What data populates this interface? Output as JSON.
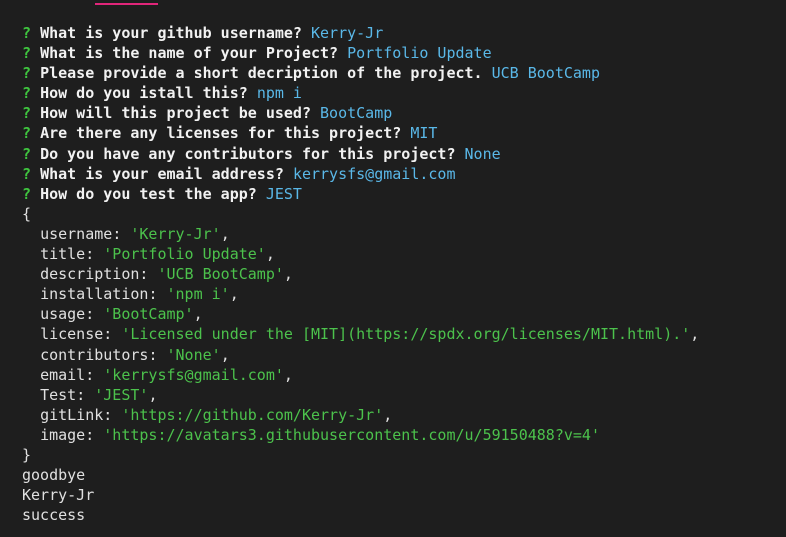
{
  "colors": {
    "background": "#1e1e1e",
    "question_mark": "#3fc53f",
    "question_text": "#f2f2f2",
    "answer": "#5ab8e8",
    "string_value": "#4cc24c",
    "plain_text": "#e0e0e0",
    "tab_indicator": "#e0267a"
  },
  "prompts": [
    {
      "mark": "?",
      "question": "What is your github username?",
      "answer": "Kerry-Jr"
    },
    {
      "mark": "?",
      "question": "What is the name of your Project?",
      "answer": "Portfolio Update"
    },
    {
      "mark": "?",
      "question": "Please provide a short decription of the project.",
      "answer": "UCB BootCamp"
    },
    {
      "mark": "?",
      "question": "How do you istall this?",
      "answer": "npm i"
    },
    {
      "mark": "?",
      "question": "How will this project be used?",
      "answer": "BootCamp"
    },
    {
      "mark": "?",
      "question": "Are there any licenses for this project?",
      "answer": "MIT"
    },
    {
      "mark": "?",
      "question": "Do you have any contributors for this project?",
      "answer": "None"
    },
    {
      "mark": "?",
      "question": "What is your email address?",
      "answer": "kerrysfs@gmail.com"
    },
    {
      "mark": "?",
      "question": "How do you test the app?",
      "answer": "JEST"
    }
  ],
  "object_output": {
    "open_brace": "{",
    "close_brace": "}",
    "entries": [
      {
        "key": "username",
        "value": "'Kerry-Jr'",
        "trail": ","
      },
      {
        "key": "title",
        "value": "'Portfolio Update'",
        "trail": ","
      },
      {
        "key": "description",
        "value": "'UCB BootCamp'",
        "trail": ","
      },
      {
        "key": "installation",
        "value": "'npm i'",
        "trail": ","
      },
      {
        "key": "usage",
        "value": "'BootCamp'",
        "trail": ","
      },
      {
        "key": "license",
        "value": "'Licensed under the [MIT](https://spdx.org/licenses/MIT.html).'",
        "trail": ","
      },
      {
        "key": "contributors",
        "value": "'None'",
        "trail": ","
      },
      {
        "key": "email",
        "value": "'kerrysfs@gmail.com'",
        "trail": ","
      },
      {
        "key": "Test",
        "value": "'JEST'",
        "trail": ","
      },
      {
        "key": "gitLink",
        "value": "'https://github.com/Kerry-Jr'",
        "trail": ","
      },
      {
        "key": "image",
        "value": "'https://avatars3.githubusercontent.com/u/59150488?v=4'",
        "trail": ""
      }
    ]
  },
  "trailing_lines": [
    "goodbye",
    "Kerry-Jr",
    "success"
  ]
}
